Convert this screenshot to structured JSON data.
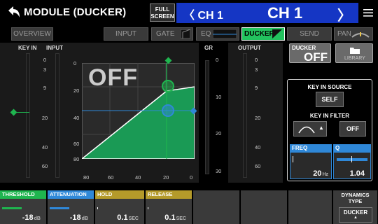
{
  "header": {
    "title": "MODULE (DUCKER)",
    "fullscreen_line1": "FULL",
    "fullscreen_line2": "SCREEN",
    "ch_left": "CH 1",
    "ch_big": "CH 1"
  },
  "tabs": {
    "overview": "OVERVIEW",
    "input": "INPUT",
    "gate": "GATE",
    "eq": "EQ",
    "ducker": "DUCKER",
    "send": "SEND",
    "pan": "PAN"
  },
  "meters": {
    "keyin": "KEY IN",
    "input": "INPUT",
    "gr": "GR",
    "output": "OUTPUT",
    "scale_left": [
      "0",
      "3",
      "9",
      "20",
      "40",
      "60"
    ],
    "gr_scale": [
      "0",
      "10",
      "20",
      "30"
    ],
    "out_scale": [
      "0",
      "3",
      "9",
      "20",
      "40",
      "60"
    ]
  },
  "graph": {
    "y_ticks": [
      "0",
      "20",
      "40",
      "60",
      "80"
    ],
    "x_ticks": [
      "80",
      "60",
      "40",
      "20",
      "0"
    ],
    "state": "OFF"
  },
  "ducker_btn": {
    "label": "DUCKER",
    "state": "OFF"
  },
  "library": {
    "label": "LIBRARY"
  },
  "key_in_source": {
    "label": "KEY IN SOURCE",
    "value": "SELF"
  },
  "key_in_filter": {
    "label": "KEY IN FILTER",
    "toggle": "OFF"
  },
  "freq": {
    "label": "FREQ",
    "value": "20",
    "unit": "Hz"
  },
  "q": {
    "label": "Q",
    "value": "1.04"
  },
  "bottom": [
    {
      "label": "THRESHOLD",
      "value": "-18",
      "unit": "dB",
      "color": "#1fb54f"
    },
    {
      "label": "ATTENUATION",
      "value": "-18",
      "unit": "dB",
      "color": "#2f88d8"
    },
    {
      "label": "HOLD",
      "value": "0.1",
      "unit": "SEC",
      "color": "#b49a2a"
    },
    {
      "label": "RELEASE",
      "value": "0.1",
      "unit": "SEC",
      "color": "#b49a2a"
    }
  ],
  "dynamics": {
    "label1": "DYNAMICS",
    "label2": "TYPE",
    "value": "DUCKER"
  },
  "colors": {
    "accent_blue": "#1536c4",
    "ducker_green": "#22c35e"
  }
}
